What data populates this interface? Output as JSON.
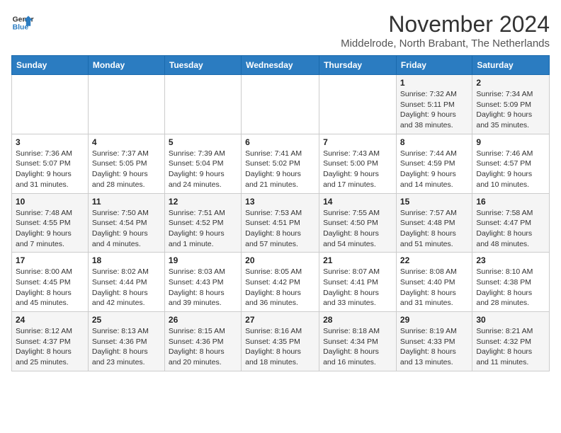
{
  "logo": {
    "line1": "General",
    "line2": "Blue"
  },
  "title": "November 2024",
  "location": "Middelrode, North Brabant, The Netherlands",
  "weekdays": [
    "Sunday",
    "Monday",
    "Tuesday",
    "Wednesday",
    "Thursday",
    "Friday",
    "Saturday"
  ],
  "weeks": [
    [
      {
        "day": "",
        "info": ""
      },
      {
        "day": "",
        "info": ""
      },
      {
        "day": "",
        "info": ""
      },
      {
        "day": "",
        "info": ""
      },
      {
        "day": "",
        "info": ""
      },
      {
        "day": "1",
        "info": "Sunrise: 7:32 AM\nSunset: 5:11 PM\nDaylight: 9 hours and 38 minutes."
      },
      {
        "day": "2",
        "info": "Sunrise: 7:34 AM\nSunset: 5:09 PM\nDaylight: 9 hours and 35 minutes."
      }
    ],
    [
      {
        "day": "3",
        "info": "Sunrise: 7:36 AM\nSunset: 5:07 PM\nDaylight: 9 hours and 31 minutes."
      },
      {
        "day": "4",
        "info": "Sunrise: 7:37 AM\nSunset: 5:05 PM\nDaylight: 9 hours and 28 minutes."
      },
      {
        "day": "5",
        "info": "Sunrise: 7:39 AM\nSunset: 5:04 PM\nDaylight: 9 hours and 24 minutes."
      },
      {
        "day": "6",
        "info": "Sunrise: 7:41 AM\nSunset: 5:02 PM\nDaylight: 9 hours and 21 minutes."
      },
      {
        "day": "7",
        "info": "Sunrise: 7:43 AM\nSunset: 5:00 PM\nDaylight: 9 hours and 17 minutes."
      },
      {
        "day": "8",
        "info": "Sunrise: 7:44 AM\nSunset: 4:59 PM\nDaylight: 9 hours and 14 minutes."
      },
      {
        "day": "9",
        "info": "Sunrise: 7:46 AM\nSunset: 4:57 PM\nDaylight: 9 hours and 10 minutes."
      }
    ],
    [
      {
        "day": "10",
        "info": "Sunrise: 7:48 AM\nSunset: 4:55 PM\nDaylight: 9 hours and 7 minutes."
      },
      {
        "day": "11",
        "info": "Sunrise: 7:50 AM\nSunset: 4:54 PM\nDaylight: 9 hours and 4 minutes."
      },
      {
        "day": "12",
        "info": "Sunrise: 7:51 AM\nSunset: 4:52 PM\nDaylight: 9 hours and 1 minute."
      },
      {
        "day": "13",
        "info": "Sunrise: 7:53 AM\nSunset: 4:51 PM\nDaylight: 8 hours and 57 minutes."
      },
      {
        "day": "14",
        "info": "Sunrise: 7:55 AM\nSunset: 4:50 PM\nDaylight: 8 hours and 54 minutes."
      },
      {
        "day": "15",
        "info": "Sunrise: 7:57 AM\nSunset: 4:48 PM\nDaylight: 8 hours and 51 minutes."
      },
      {
        "day": "16",
        "info": "Sunrise: 7:58 AM\nSunset: 4:47 PM\nDaylight: 8 hours and 48 minutes."
      }
    ],
    [
      {
        "day": "17",
        "info": "Sunrise: 8:00 AM\nSunset: 4:45 PM\nDaylight: 8 hours and 45 minutes."
      },
      {
        "day": "18",
        "info": "Sunrise: 8:02 AM\nSunset: 4:44 PM\nDaylight: 8 hours and 42 minutes."
      },
      {
        "day": "19",
        "info": "Sunrise: 8:03 AM\nSunset: 4:43 PM\nDaylight: 8 hours and 39 minutes."
      },
      {
        "day": "20",
        "info": "Sunrise: 8:05 AM\nSunset: 4:42 PM\nDaylight: 8 hours and 36 minutes."
      },
      {
        "day": "21",
        "info": "Sunrise: 8:07 AM\nSunset: 4:41 PM\nDaylight: 8 hours and 33 minutes."
      },
      {
        "day": "22",
        "info": "Sunrise: 8:08 AM\nSunset: 4:40 PM\nDaylight: 8 hours and 31 minutes."
      },
      {
        "day": "23",
        "info": "Sunrise: 8:10 AM\nSunset: 4:38 PM\nDaylight: 8 hours and 28 minutes."
      }
    ],
    [
      {
        "day": "24",
        "info": "Sunrise: 8:12 AM\nSunset: 4:37 PM\nDaylight: 8 hours and 25 minutes."
      },
      {
        "day": "25",
        "info": "Sunrise: 8:13 AM\nSunset: 4:36 PM\nDaylight: 8 hours and 23 minutes."
      },
      {
        "day": "26",
        "info": "Sunrise: 8:15 AM\nSunset: 4:36 PM\nDaylight: 8 hours and 20 minutes."
      },
      {
        "day": "27",
        "info": "Sunrise: 8:16 AM\nSunset: 4:35 PM\nDaylight: 8 hours and 18 minutes."
      },
      {
        "day": "28",
        "info": "Sunrise: 8:18 AM\nSunset: 4:34 PM\nDaylight: 8 hours and 16 minutes."
      },
      {
        "day": "29",
        "info": "Sunrise: 8:19 AM\nSunset: 4:33 PM\nDaylight: 8 hours and 13 minutes."
      },
      {
        "day": "30",
        "info": "Sunrise: 8:21 AM\nSunset: 4:32 PM\nDaylight: 8 hours and 11 minutes."
      }
    ]
  ]
}
